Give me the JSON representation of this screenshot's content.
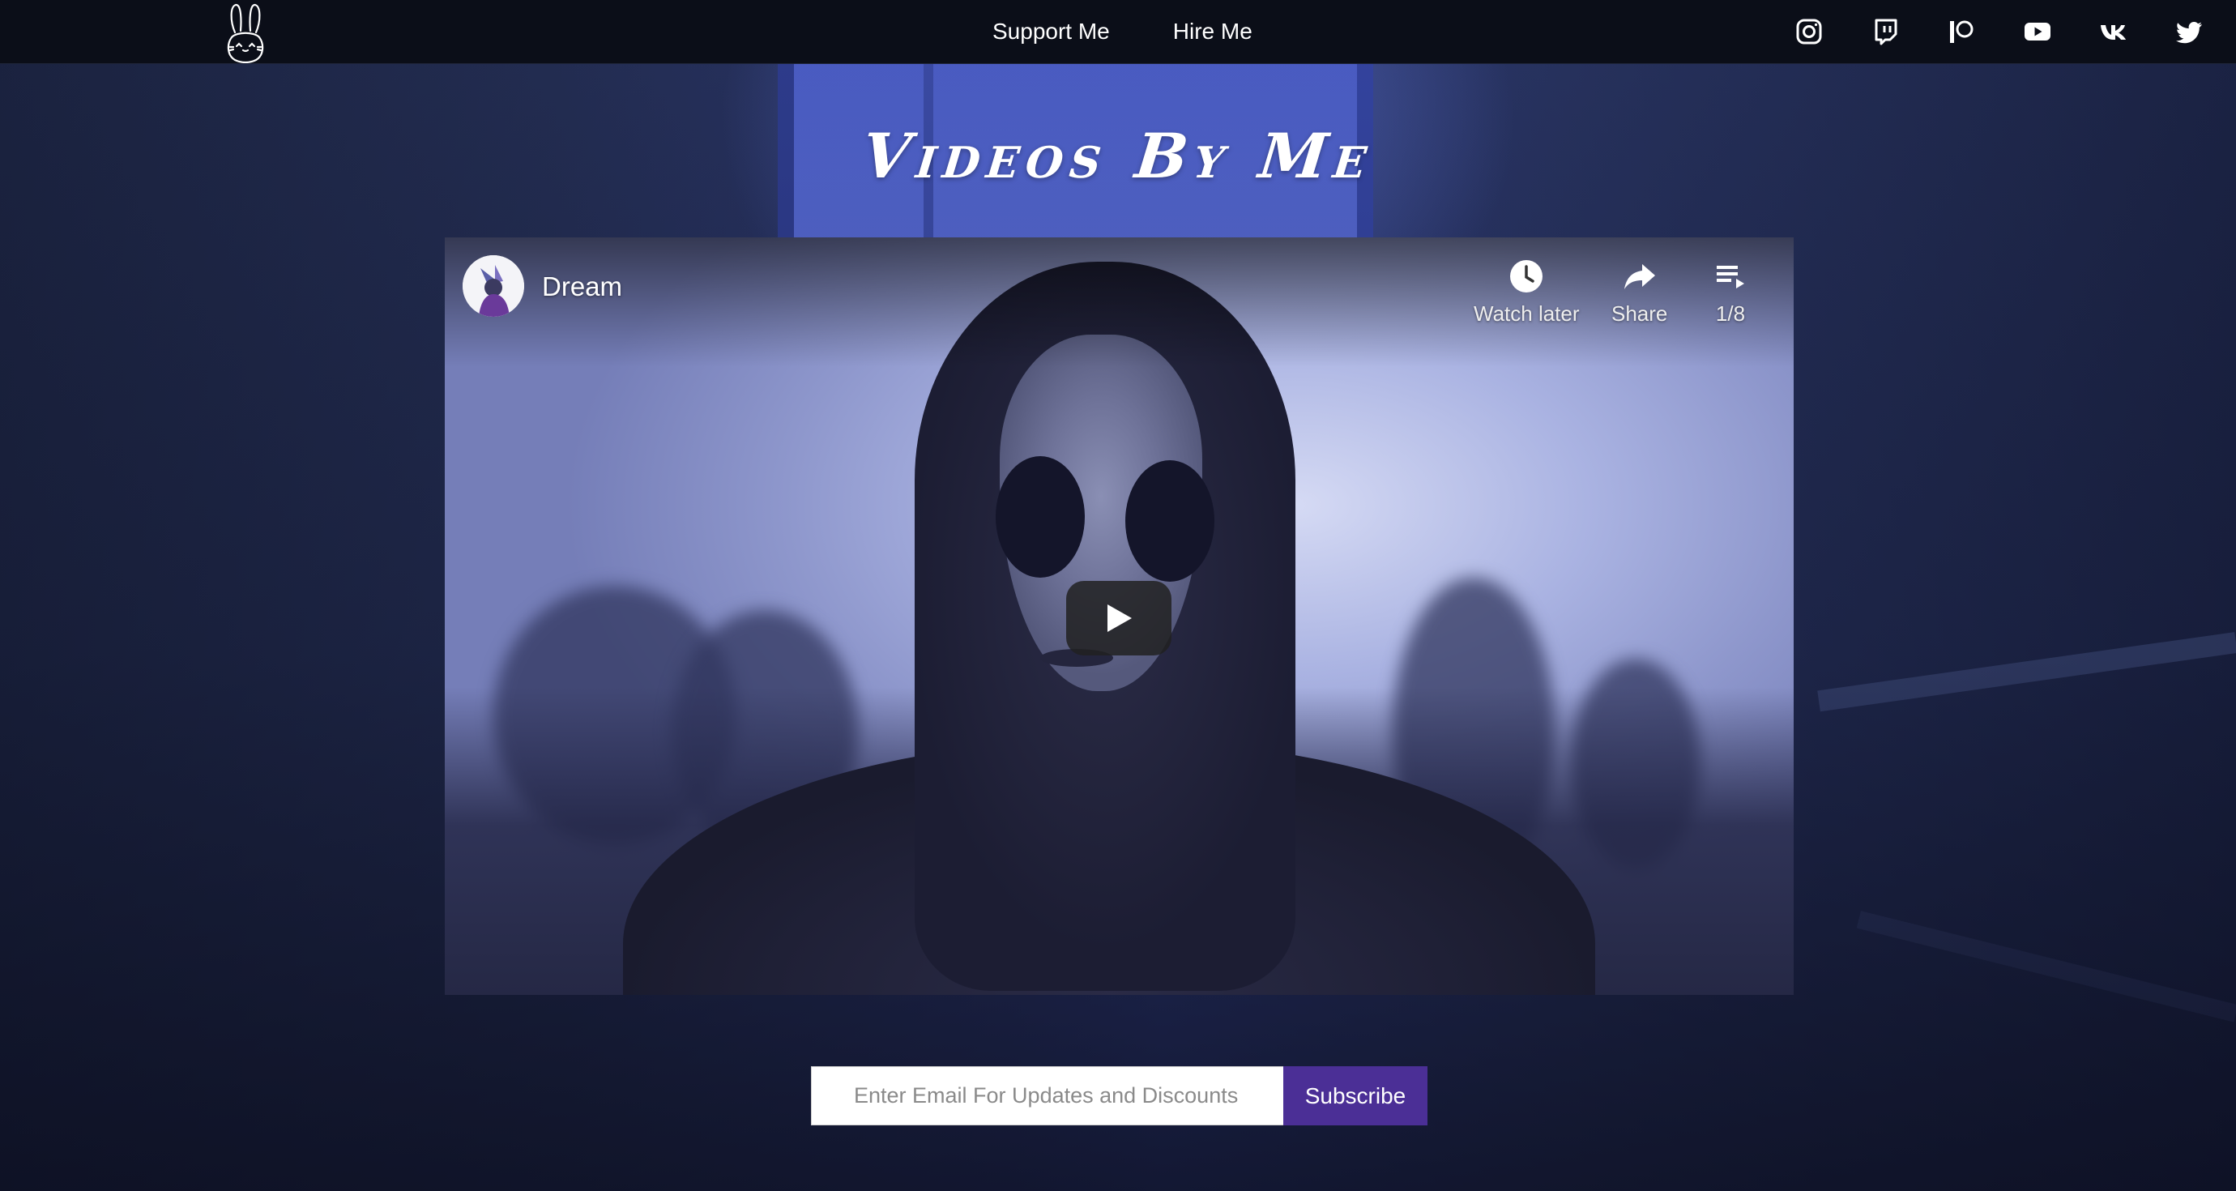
{
  "nav": {
    "logo_icon": "bunny-logo-icon",
    "links": [
      {
        "label": "Support Me"
      },
      {
        "label": "Hire Me"
      }
    ],
    "socials": [
      {
        "name": "instagram-icon"
      },
      {
        "name": "twitch-icon"
      },
      {
        "name": "patreon-icon"
      },
      {
        "name": "youtube-icon"
      },
      {
        "name": "vk-icon"
      },
      {
        "name": "twitter-icon"
      }
    ]
  },
  "page": {
    "title": "Videos By Me"
  },
  "player": {
    "video_title": "Dream",
    "actions": {
      "watch_later": "Watch later",
      "share": "Share",
      "playlist_position": "1/8"
    },
    "play_icon": "play-icon"
  },
  "subscribe": {
    "placeholder": "Enter Email For Updates and Discounts",
    "button_label": "Subscribe"
  },
  "colors": {
    "navbar": "#0b0e18",
    "subscribe_button": "#4b2f96"
  }
}
